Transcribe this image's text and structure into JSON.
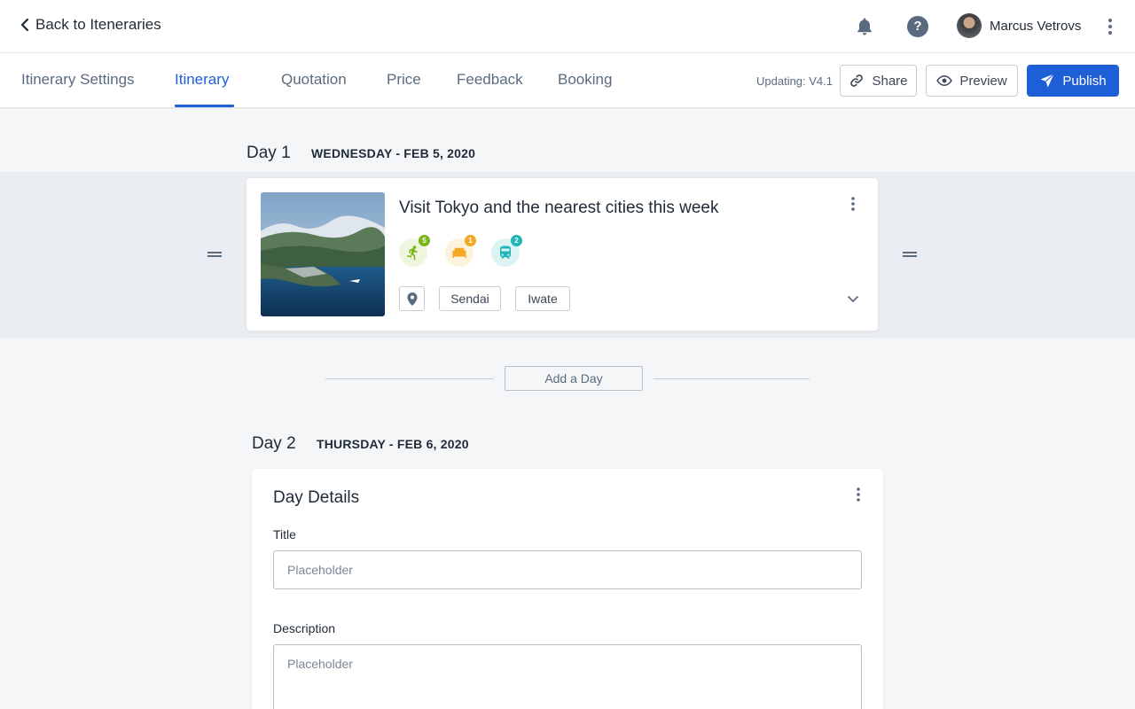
{
  "header": {
    "back_label": "Back to Iteneraries",
    "user_name": "Marcus Vetrovs",
    "help_glyph": "?"
  },
  "tabs": [
    {
      "label": "Itinerary Settings",
      "active": false
    },
    {
      "label": "Itinerary",
      "active": true
    },
    {
      "label": "Quotation",
      "active": false
    },
    {
      "label": "Price",
      "active": false
    },
    {
      "label": "Feedback",
      "active": false
    },
    {
      "label": "Booking",
      "active": false
    }
  ],
  "toolbar": {
    "version_label": "Updating: V4.1",
    "share_label": "Share",
    "preview_label": "Preview",
    "publish_label": "Publish"
  },
  "days": [
    {
      "title": "Day 1",
      "date": "WEDNESDAY - FEB 5, 2020",
      "card": {
        "title": "Visit Tokyo and the nearest cities this week",
        "amenities": [
          {
            "icon": "activity-icon",
            "count": "5",
            "color": "#7cb518"
          },
          {
            "icon": "hotel-icon",
            "count": "1",
            "color": "#f5a623"
          },
          {
            "icon": "train-icon",
            "count": "2",
            "color": "#1fb5b5"
          }
        ],
        "locations": [
          "Sendai",
          "Iwate"
        ]
      }
    },
    {
      "title": "Day 2",
      "date": "THURSDAY - FEB 6, 2020"
    }
  ],
  "add_day_label": "Add a Day",
  "day_details": {
    "heading": "Day Details",
    "title_label": "Title",
    "title_placeholder": "Placeholder",
    "description_label": "Description",
    "description_placeholder": "Placeholder"
  },
  "colors": {
    "primary": "#1f5fd6",
    "muted": "#5a6b80",
    "background": "#f4f6f8"
  }
}
